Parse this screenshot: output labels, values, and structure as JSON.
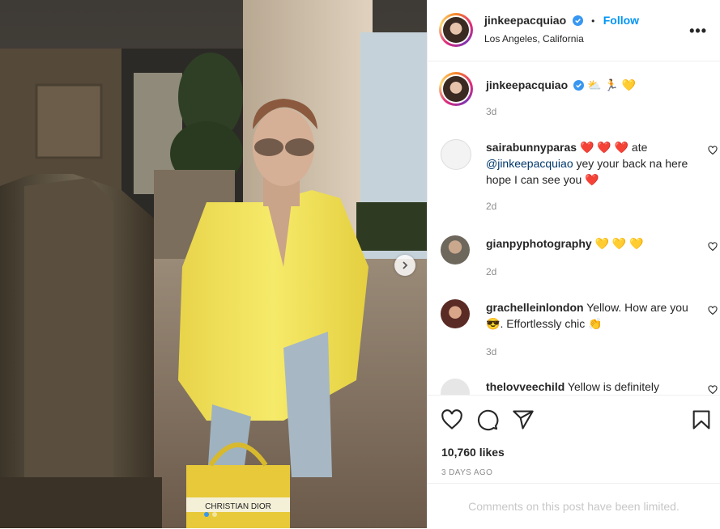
{
  "post": {
    "username": "jinkeepacquiao",
    "follow_label": "Follow",
    "separator": "•",
    "location": "Los Angeles, California",
    "caption_emoji": "⛅ 🏃 💛",
    "caption_time": "3d",
    "likes": "10,760 likes",
    "date": "3 DAYS AGO",
    "comments_limited": "Comments on this post have been limited.",
    "image_text": "CHRISTIAN DIOR"
  },
  "comments": [
    {
      "user": "sairabunnyparas",
      "emoji": "❤️ ❤️ ❤️",
      "text_a": "ate",
      "mention": "@jinkeepacquiao",
      "text_b": "yey your back na here hope I can see you",
      "emoji_end": "❤️",
      "time": "2d"
    },
    {
      "user": "gianpyphotography",
      "emoji": "💛 💛 💛",
      "time": "2d"
    },
    {
      "user": "grachelleinlondon",
      "text_a": "Yellow. How are you",
      "emoji_mid": "😎",
      "text_b": ". Effortlessly chic",
      "emoji_end": "👏",
      "time": "3d"
    },
    {
      "user": "thelovveechild",
      "text_a": "Yellow is definitely"
    }
  ],
  "icons": [
    "verified-icon",
    "more-icon",
    "heart-icon",
    "comment-icon",
    "share-icon",
    "save-icon",
    "chevron-right-icon"
  ],
  "colors": {
    "accent": "#0095f6",
    "shirt": "#f2e35a",
    "heart": "#ed4956"
  }
}
